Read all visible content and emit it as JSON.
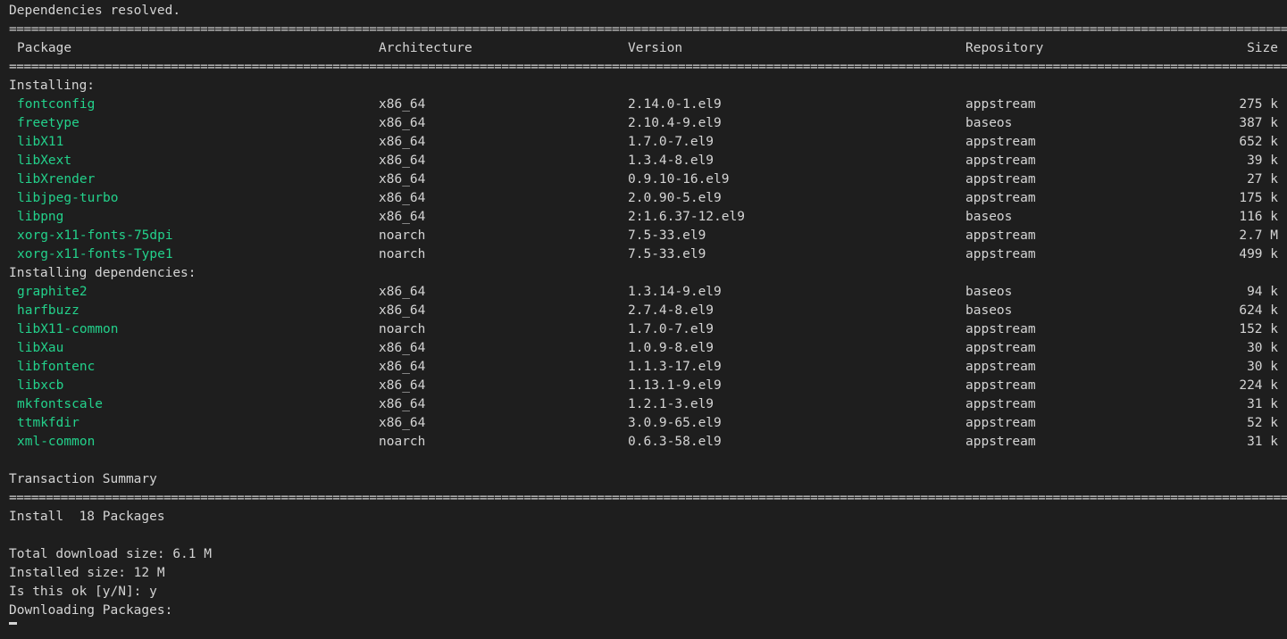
{
  "terminal": {
    "header_line": "Dependencies resolved.",
    "separator": "================================================================================================================================================================================",
    "columns": {
      "package": "Package",
      "architecture": "Architecture",
      "version": "Version",
      "repository": "Repository",
      "size": "Size"
    },
    "installing_label": "Installing:",
    "installing": [
      {
        "name": "fontconfig",
        "arch": "x86_64",
        "version": "2.14.0-1.el9",
        "repo": "appstream",
        "size": "275 k"
      },
      {
        "name": "freetype",
        "arch": "x86_64",
        "version": "2.10.4-9.el9",
        "repo": "baseos",
        "size": "387 k"
      },
      {
        "name": "libX11",
        "arch": "x86_64",
        "version": "1.7.0-7.el9",
        "repo": "appstream",
        "size": "652 k"
      },
      {
        "name": "libXext",
        "arch": "x86_64",
        "version": "1.3.4-8.el9",
        "repo": "appstream",
        "size": "39 k"
      },
      {
        "name": "libXrender",
        "arch": "x86_64",
        "version": "0.9.10-16.el9",
        "repo": "appstream",
        "size": "27 k"
      },
      {
        "name": "libjpeg-turbo",
        "arch": "x86_64",
        "version": "2.0.90-5.el9",
        "repo": "appstream",
        "size": "175 k"
      },
      {
        "name": "libpng",
        "arch": "x86_64",
        "version": "2:1.6.37-12.el9",
        "repo": "baseos",
        "size": "116 k"
      },
      {
        "name": "xorg-x11-fonts-75dpi",
        "arch": "noarch",
        "version": "7.5-33.el9",
        "repo": "appstream",
        "size": "2.7 M"
      },
      {
        "name": "xorg-x11-fonts-Type1",
        "arch": "noarch",
        "version": "7.5-33.el9",
        "repo": "appstream",
        "size": "499 k"
      }
    ],
    "deps_label": "Installing dependencies:",
    "dependencies": [
      {
        "name": "graphite2",
        "arch": "x86_64",
        "version": "1.3.14-9.el9",
        "repo": "baseos",
        "size": "94 k"
      },
      {
        "name": "harfbuzz",
        "arch": "x86_64",
        "version": "2.7.4-8.el9",
        "repo": "baseos",
        "size": "624 k"
      },
      {
        "name": "libX11-common",
        "arch": "noarch",
        "version": "1.7.0-7.el9",
        "repo": "appstream",
        "size": "152 k"
      },
      {
        "name": "libXau",
        "arch": "x86_64",
        "version": "1.0.9-8.el9",
        "repo": "appstream",
        "size": "30 k"
      },
      {
        "name": "libfontenc",
        "arch": "x86_64",
        "version": "1.1.3-17.el9",
        "repo": "appstream",
        "size": "30 k"
      },
      {
        "name": "libxcb",
        "arch": "x86_64",
        "version": "1.13.1-9.el9",
        "repo": "appstream",
        "size": "224 k"
      },
      {
        "name": "mkfontscale",
        "arch": "x86_64",
        "version": "1.2.1-3.el9",
        "repo": "appstream",
        "size": "31 k"
      },
      {
        "name": "ttmkfdir",
        "arch": "x86_64",
        "version": "3.0.9-65.el9",
        "repo": "appstream",
        "size": "52 k"
      },
      {
        "name": "xml-common",
        "arch": "noarch",
        "version": "0.6.3-58.el9",
        "repo": "appstream",
        "size": "31 k"
      }
    ],
    "summary_title": "Transaction Summary",
    "install_summary": "Install  18 Packages",
    "total_download": "Total download size: 6.1 M",
    "installed_size": "Installed size: 12 M",
    "prompt": "Is this ok [y/N]: y",
    "downloading": "Downloading Packages:"
  },
  "colors": {
    "background": "#1e1e1e",
    "text": "#d4d4d4",
    "package_name": "#23d18b"
  }
}
